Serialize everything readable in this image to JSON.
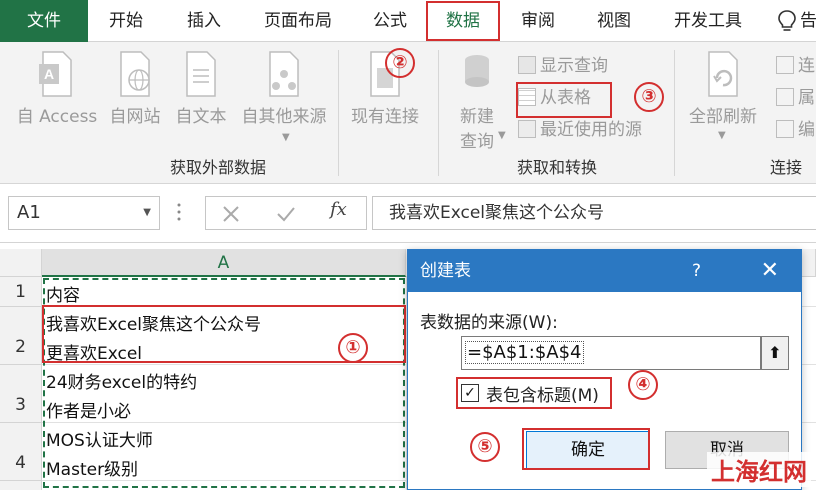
{
  "tabs": [
    {
      "label": "文件"
    },
    {
      "label": "开始"
    },
    {
      "label": "插入"
    },
    {
      "label": "页面布局"
    },
    {
      "label": "公式"
    },
    {
      "label": "数据"
    },
    {
      "label": "审阅"
    },
    {
      "label": "视图"
    },
    {
      "label": "开发工具"
    }
  ],
  "tab_truncated": "告",
  "ribbon": {
    "ext_group": {
      "label": "获取外部数据",
      "buttons": [
        {
          "label": "自 Access"
        },
        {
          "label": "自网站"
        },
        {
          "label": "自文本"
        },
        {
          "label": "自其他来源"
        },
        {
          "label": "现有连接"
        }
      ]
    },
    "transform_group": {
      "label": "获取和转换",
      "new_query_line1": "新建",
      "new_query_line2": "查询",
      "show_query": "显示查询",
      "from_table": "从表格",
      "recent_sources": "最近使用的源"
    },
    "conn_group": {
      "label": "连接",
      "refresh_all": "全部刷新",
      "trunc1": "连",
      "trunc2": "属",
      "trunc3": "编"
    }
  },
  "formula_bar": {
    "name_box": "A1",
    "fx": "fx",
    "content": "我喜欢Excel聚焦这个公众号"
  },
  "sheet": {
    "column": "A",
    "rows": [
      {
        "num": "1",
        "lines": [
          "内容"
        ]
      },
      {
        "num": "2",
        "lines": [
          "我喜欢Excel聚焦这个公众号",
          "更喜欢Excel"
        ]
      },
      {
        "num": "3",
        "lines": [
          "24财务excel的特约",
          "作者是小必"
        ]
      },
      {
        "num": "4",
        "lines": [
          "MOS认证大师",
          "Master级别"
        ]
      }
    ]
  },
  "dialog": {
    "title": "创建表",
    "help": "?",
    "close": "✕",
    "source_label": "表数据的来源(W):",
    "range_value": "=$A$1:$A$4",
    "has_headers_label": "表包含标题(M)",
    "has_headers_checked": true,
    "ok": "确定",
    "cancel": "取消"
  },
  "annotations": [
    "①",
    "②",
    "③",
    "④",
    "⑤"
  ],
  "watermark": "上海红网",
  "colors": {
    "excel_green": "#217346",
    "highlight_red": "#d32f2f",
    "dialog_blue": "#2b78c2"
  }
}
